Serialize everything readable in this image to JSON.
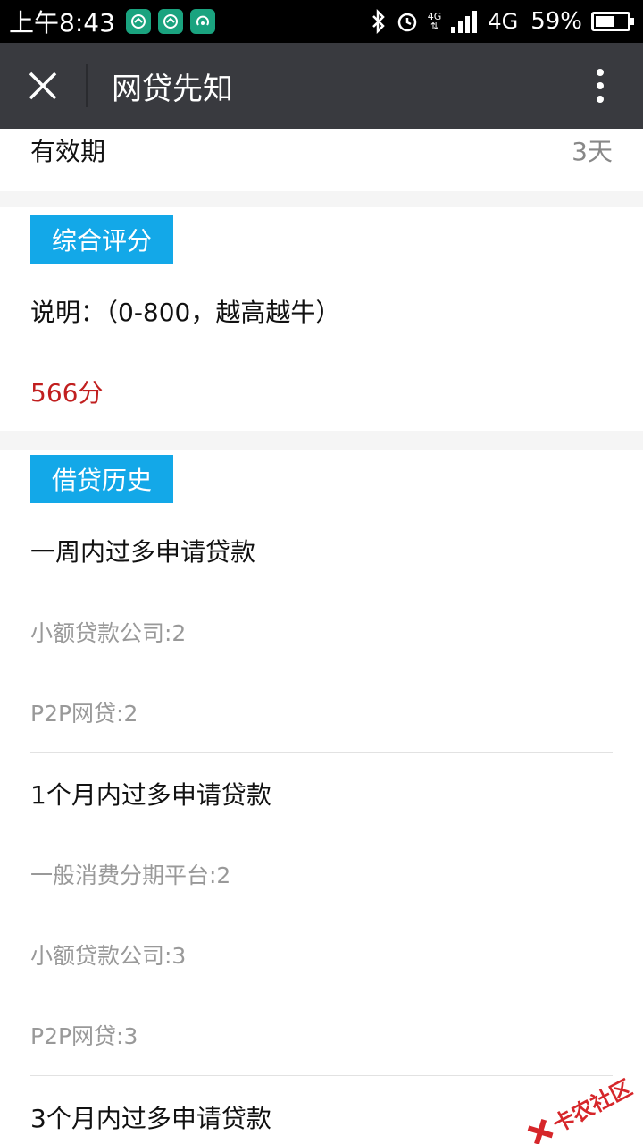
{
  "status_bar": {
    "time": "上午8:43",
    "network_small": "4G",
    "network": "4G",
    "battery_percent": "59%",
    "battery_level": 0.59
  },
  "title_bar": {
    "title": "网贷先知"
  },
  "validity": {
    "label": "有效期",
    "value": "3天"
  },
  "score_section": {
    "tag": "综合评分",
    "note": "说明：（0-800，越高越牛）",
    "score": "566分"
  },
  "history_section": {
    "tag": "借贷历史",
    "groups": [
      {
        "title": "一周内过多申请贷款",
        "items": [
          "小额贷款公司:2",
          "P2P网贷:2"
        ]
      },
      {
        "title": "1个月内过多申请贷款",
        "items": [
          "一般消费分期平台:2",
          "小额贷款公司:3",
          "P2P网贷:3"
        ]
      },
      {
        "title": "3个月内过多申请贷款",
        "items": []
      }
    ]
  },
  "watermark": {
    "text": "卡农社区"
  },
  "colors": {
    "tag_bg": "#13a8e8",
    "score_red": "#c11f1f",
    "title_bar": "#393a3f"
  }
}
